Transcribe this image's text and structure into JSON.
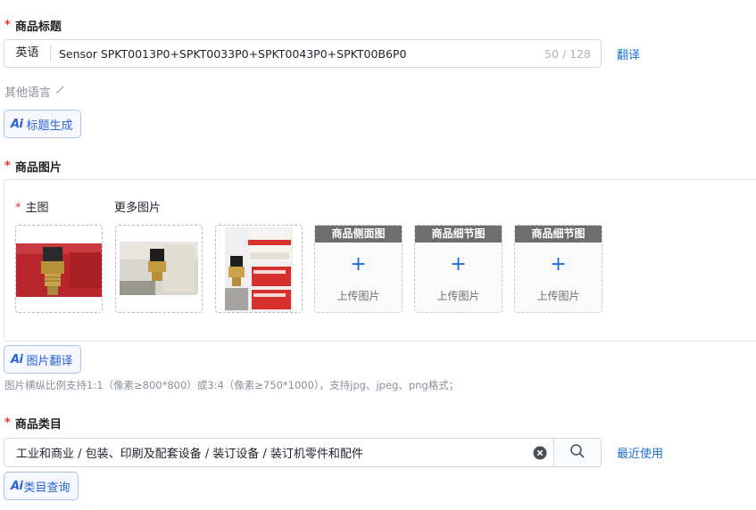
{
  "title_section": {
    "label": "商品标题",
    "lang_tag": "英语",
    "title_value": "Sensor SPKT0013P0+SPKT0033P0+SPKT0043P0+SPKT00B6P0",
    "char_count": "50 / 128",
    "translate_link": "翻译",
    "other_lang": "其他语言",
    "ai_logo": "Ai",
    "ai_button": "标题生成"
  },
  "image_section": {
    "label": "商品图片",
    "main_label": "主图",
    "more_label": "更多图片",
    "slots": [
      {
        "header": "商品侧面图",
        "upload": "上传图片"
      },
      {
        "header": "商品细节图",
        "upload": "上传图片"
      },
      {
        "header": "商品细节图",
        "upload": "上传图片"
      }
    ],
    "ai_logo": "Ai",
    "ai_button": "图片翻译",
    "hint": "图片横纵比例支持1:1（像素≥800*800）或3:4（像素≥750*1000），支持jpg、jpeg、png格式；"
  },
  "category_section": {
    "label": "商品类目",
    "value": "工业和商业 / 包装、印刷及配套设备 / 装订设备 / 装订机零件和配件",
    "recent_link": "最近使用",
    "ai_logo": "Ai",
    "ai_button": "类目查询"
  },
  "colors": {
    "required": "#e8352e",
    "link": "#1b6fd1",
    "ai_accent": "#2a62d6"
  },
  "icons": [
    "edit-pencil-icon",
    "plus-icon",
    "clear-circle-icon",
    "search-icon"
  ]
}
